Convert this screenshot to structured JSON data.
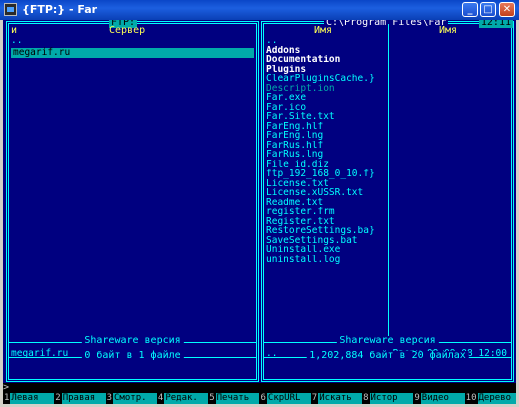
{
  "window": {
    "title": "{FTP:} - Far",
    "buttons": {
      "minimize": "_",
      "maximize": "□",
      "close": "✕"
    }
  },
  "left_panel": {
    "title": "FTP:",
    "columns": [
      "и",
      "Сервер"
    ],
    "items": [
      ".."
    ],
    "selected_item": "megarif.ru",
    "status_label": "Shareware версия",
    "status_file": "megarif.ru",
    "summary": "0 байт в 1 файле"
  },
  "right_panel": {
    "title": "C:\\Program Files\\Far",
    "clock": "12:11",
    "columns": [
      "Имя",
      "Имя"
    ],
    "items": [
      {
        "name": "..",
        "style": "normal"
      },
      {
        "name": "Addons",
        "style": "bold"
      },
      {
        "name": "Documentation",
        "style": "bold"
      },
      {
        "name": "Plugins",
        "style": "bold"
      },
      {
        "name": "ClearPluginsCache.}",
        "style": "normal"
      },
      {
        "name": "Descript.ion",
        "style": "dim"
      },
      {
        "name": "Far.exe",
        "style": "normal"
      },
      {
        "name": "Far.ico",
        "style": "normal"
      },
      {
        "name": "Far.Site.txt",
        "style": "normal"
      },
      {
        "name": "FarEng.hlf",
        "style": "normal"
      },
      {
        "name": "FarEng.lng",
        "style": "normal"
      },
      {
        "name": "FarRus.hlf",
        "style": "normal"
      },
      {
        "name": "FarRus.lng",
        "style": "normal"
      },
      {
        "name": "File_id.diz",
        "style": "normal"
      },
      {
        "name": "ftp_192_168_0_10.f}",
        "style": "normal"
      },
      {
        "name": "License.txt",
        "style": "normal"
      },
      {
        "name": "License.xUSSR.txt",
        "style": "normal"
      },
      {
        "name": "Readme.txt",
        "style": "normal"
      },
      {
        "name": "register.frm",
        "style": "normal"
      },
      {
        "name": "Register.txt",
        "style": "normal"
      },
      {
        "name": "RestoreSettings.ba}",
        "style": "normal"
      },
      {
        "name": "SaveSettings.bat",
        "style": "normal"
      },
      {
        "name": "Uninstall.exe",
        "style": "normal"
      },
      {
        "name": "uninstall.log",
        "style": "normal"
      }
    ],
    "status_label": "Shareware версия",
    "status_file": "..",
    "status_info": "Вверх 08.09.08 12:00",
    "summary": "1,202,884 байт в 20 файлах"
  },
  "command_line": {
    "prompt": ">"
  },
  "keybar": [
    {
      "num": "1",
      "label": "Левая"
    },
    {
      "num": "2",
      "label": "Правая"
    },
    {
      "num": "3",
      "label": "Смотр."
    },
    {
      "num": "4",
      "label": "Редак."
    },
    {
      "num": "5",
      "label": "Печать"
    },
    {
      "num": "6",
      "label": "СкрURL"
    },
    {
      "num": "7",
      "label": "Искать"
    },
    {
      "num": "8",
      "label": "Истор"
    },
    {
      "num": "9",
      "label": "Видео"
    },
    {
      "num": "10",
      "label": "Дерево"
    }
  ],
  "colors": {
    "console_bg": "#000080",
    "panel_border": "#00ffff",
    "highlight": "#00aaaa",
    "header_text": "#ffff55"
  }
}
